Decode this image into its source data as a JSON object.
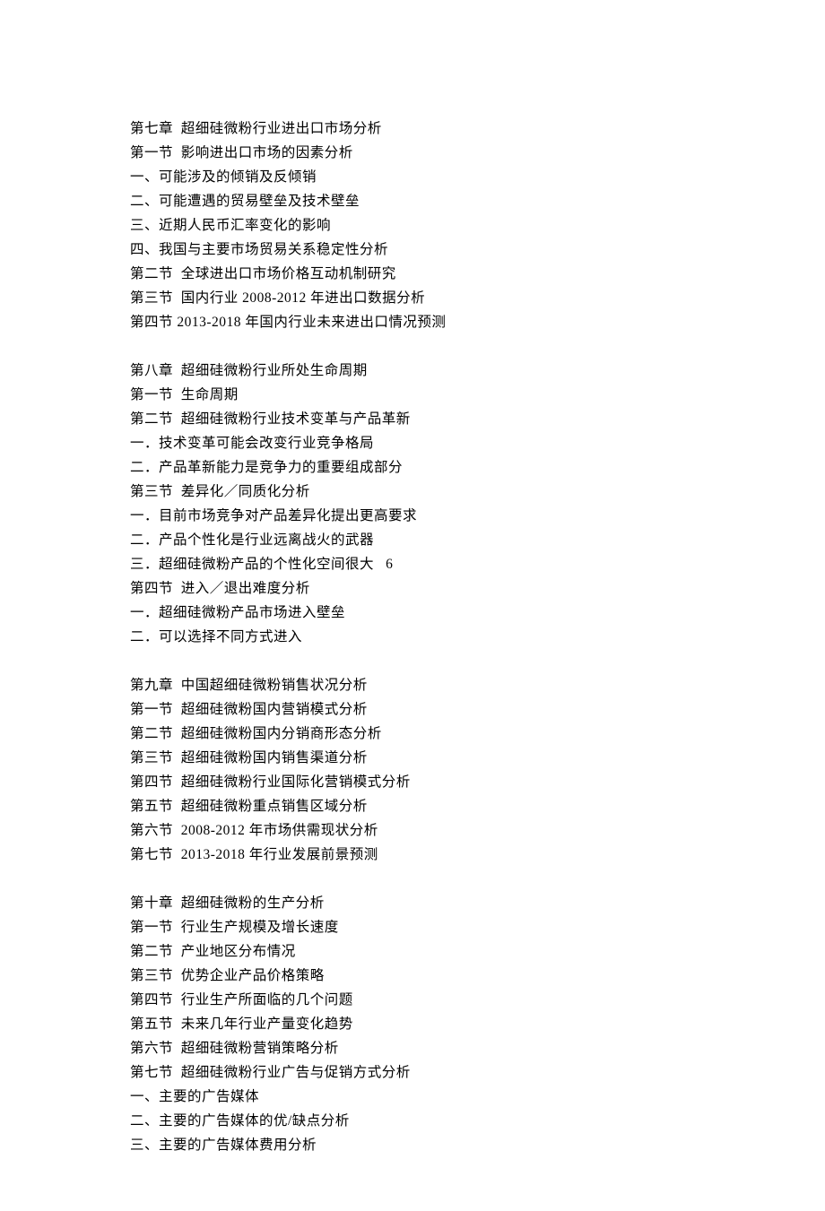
{
  "chapter7": {
    "title": "第七章  超细硅微粉行业进出口市场分析",
    "lines": [
      "第一节  影响进出口市场的因素分析",
      "一、可能涉及的倾销及反倾销",
      "二、可能遭遇的贸易壁垒及技术壁垒",
      "三、近期人民币汇率变化的影响",
      "四、我国与主要市场贸易关系稳定性分析",
      "第二节  全球进出口市场价格互动机制研究",
      "第三节  国内行业 2008-2012 年进出口数据分析",
      "第四节 2013-2018 年国内行业未来进出口情况预测"
    ]
  },
  "chapter8": {
    "title": "第八章  超细硅微粉行业所处生命周期",
    "lines": [
      "第一节  生命周期",
      "第二节  超细硅微粉行业技术变革与产品革新",
      "一．技术变革可能会改变行业竞争格局",
      "二．产品革新能力是竞争力的重要组成部分",
      "第三节  差异化／同质化分析",
      "一．目前市场竞争对产品差异化提出更高要求",
      "二．产品个性化是行业远离战火的武器",
      "三．超细硅微粉产品的个性化空间很大   6",
      "第四节  进入／退出难度分析",
      "一．超细硅微粉产品市场进入壁垒",
      "二．可以选择不同方式进入"
    ]
  },
  "chapter9": {
    "title": "第九章  中国超细硅微粉销售状况分析",
    "lines": [
      "第一节  超细硅微粉国内营销模式分析",
      "第二节  超细硅微粉国内分销商形态分析",
      "第三节  超细硅微粉国内销售渠道分析",
      "第四节  超细硅微粉行业国际化营销模式分析",
      "第五节  超细硅微粉重点销售区域分析",
      "第六节  2008-2012 年市场供需现状分析",
      "第七节  2013-2018 年行业发展前景预测"
    ]
  },
  "chapter10": {
    "title": "第十章  超细硅微粉的生产分析",
    "lines": [
      "第一节  行业生产规模及增长速度",
      "第二节  产业地区分布情况",
      "第三节  优势企业产品价格策略",
      "第四节  行业生产所面临的几个问题",
      "第五节  未来几年行业产量变化趋势",
      "第六节  超细硅微粉营销策略分析",
      "第七节  超细硅微粉行业广告与促销方式分析",
      "一、主要的广告媒体",
      "二、主要的广告媒体的优/缺点分析",
      "三、主要的广告媒体费用分析"
    ]
  }
}
